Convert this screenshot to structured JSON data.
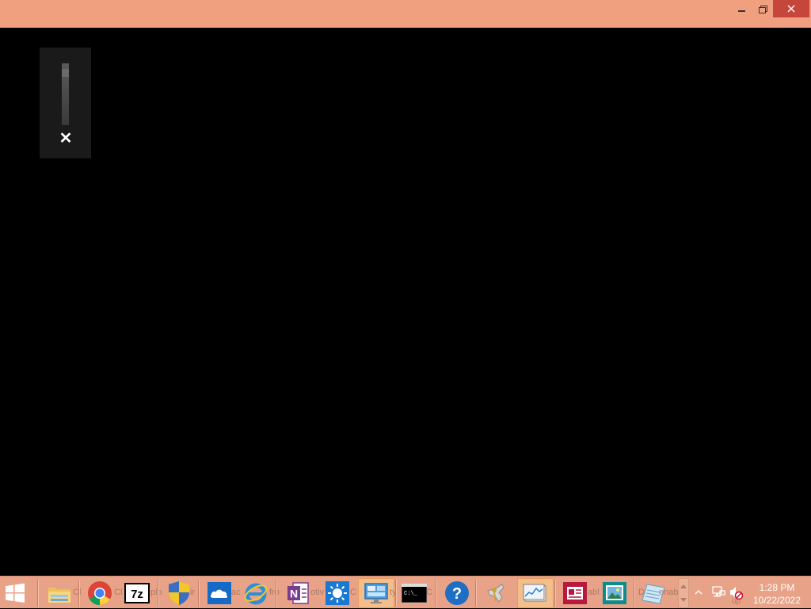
{
  "window": {
    "controls": {
      "minimize": "minimize",
      "restore": "restore",
      "close": "close"
    }
  },
  "volume_flyout": {
    "close_glyph": "✕",
    "level": 0.9
  },
  "taskbar": {
    "start_icon": "windows-logo-icon",
    "items": [
      {
        "name": "file-explorer",
        "icon": "folder-icon"
      },
      {
        "name": "chrome",
        "icon": "chrome-icon"
      },
      {
        "name": "7zip",
        "icon": "7zip-icon",
        "label": "7z"
      },
      {
        "name": "uac",
        "icon": "shield-icon"
      },
      {
        "name": "onedrive",
        "icon": "cloud-icon"
      },
      {
        "name": "internet-explorer",
        "icon": "ie-icon"
      },
      {
        "name": "onenote",
        "icon": "onenote-icon",
        "label": "N"
      },
      {
        "name": "brightness",
        "icon": "sun-icon"
      },
      {
        "name": "display",
        "icon": "monitor-icon"
      },
      {
        "name": "command-prompt",
        "icon": "cmd-icon",
        "label": "C:\\_"
      },
      {
        "name": "help",
        "icon": "help-icon",
        "label": "?"
      },
      {
        "name": "keys",
        "icon": "keys-icon"
      },
      {
        "name": "performance",
        "icon": "chart-icon"
      },
      {
        "name": "reader",
        "icon": "news-icon"
      },
      {
        "name": "photo-viewer",
        "icon": "image-icon"
      },
      {
        "name": "notepad",
        "icon": "notepad-icon"
      }
    ],
    "ghost_text": {
      "a": "Cl",
      "b": "plo",
      "c": "ir",
      "d": "ac",
      "e": "fro",
      "f": "otiv",
      "g": "C",
      "h": "ty",
      "i": "abl",
      "j": "D",
      "k": "enable",
      "l": "up"
    }
  },
  "tray": {
    "overflow_icon": "chevron-up-icon",
    "network_icon": "network-icon",
    "volume_icon": "volume-muted-icon"
  },
  "clock": {
    "time": "1:28 PM",
    "date": "10/22/2022"
  },
  "colors": {
    "titlebar": "#f0a07f",
    "taskbar": "#e8a287",
    "close_hover": "#c7463b"
  }
}
